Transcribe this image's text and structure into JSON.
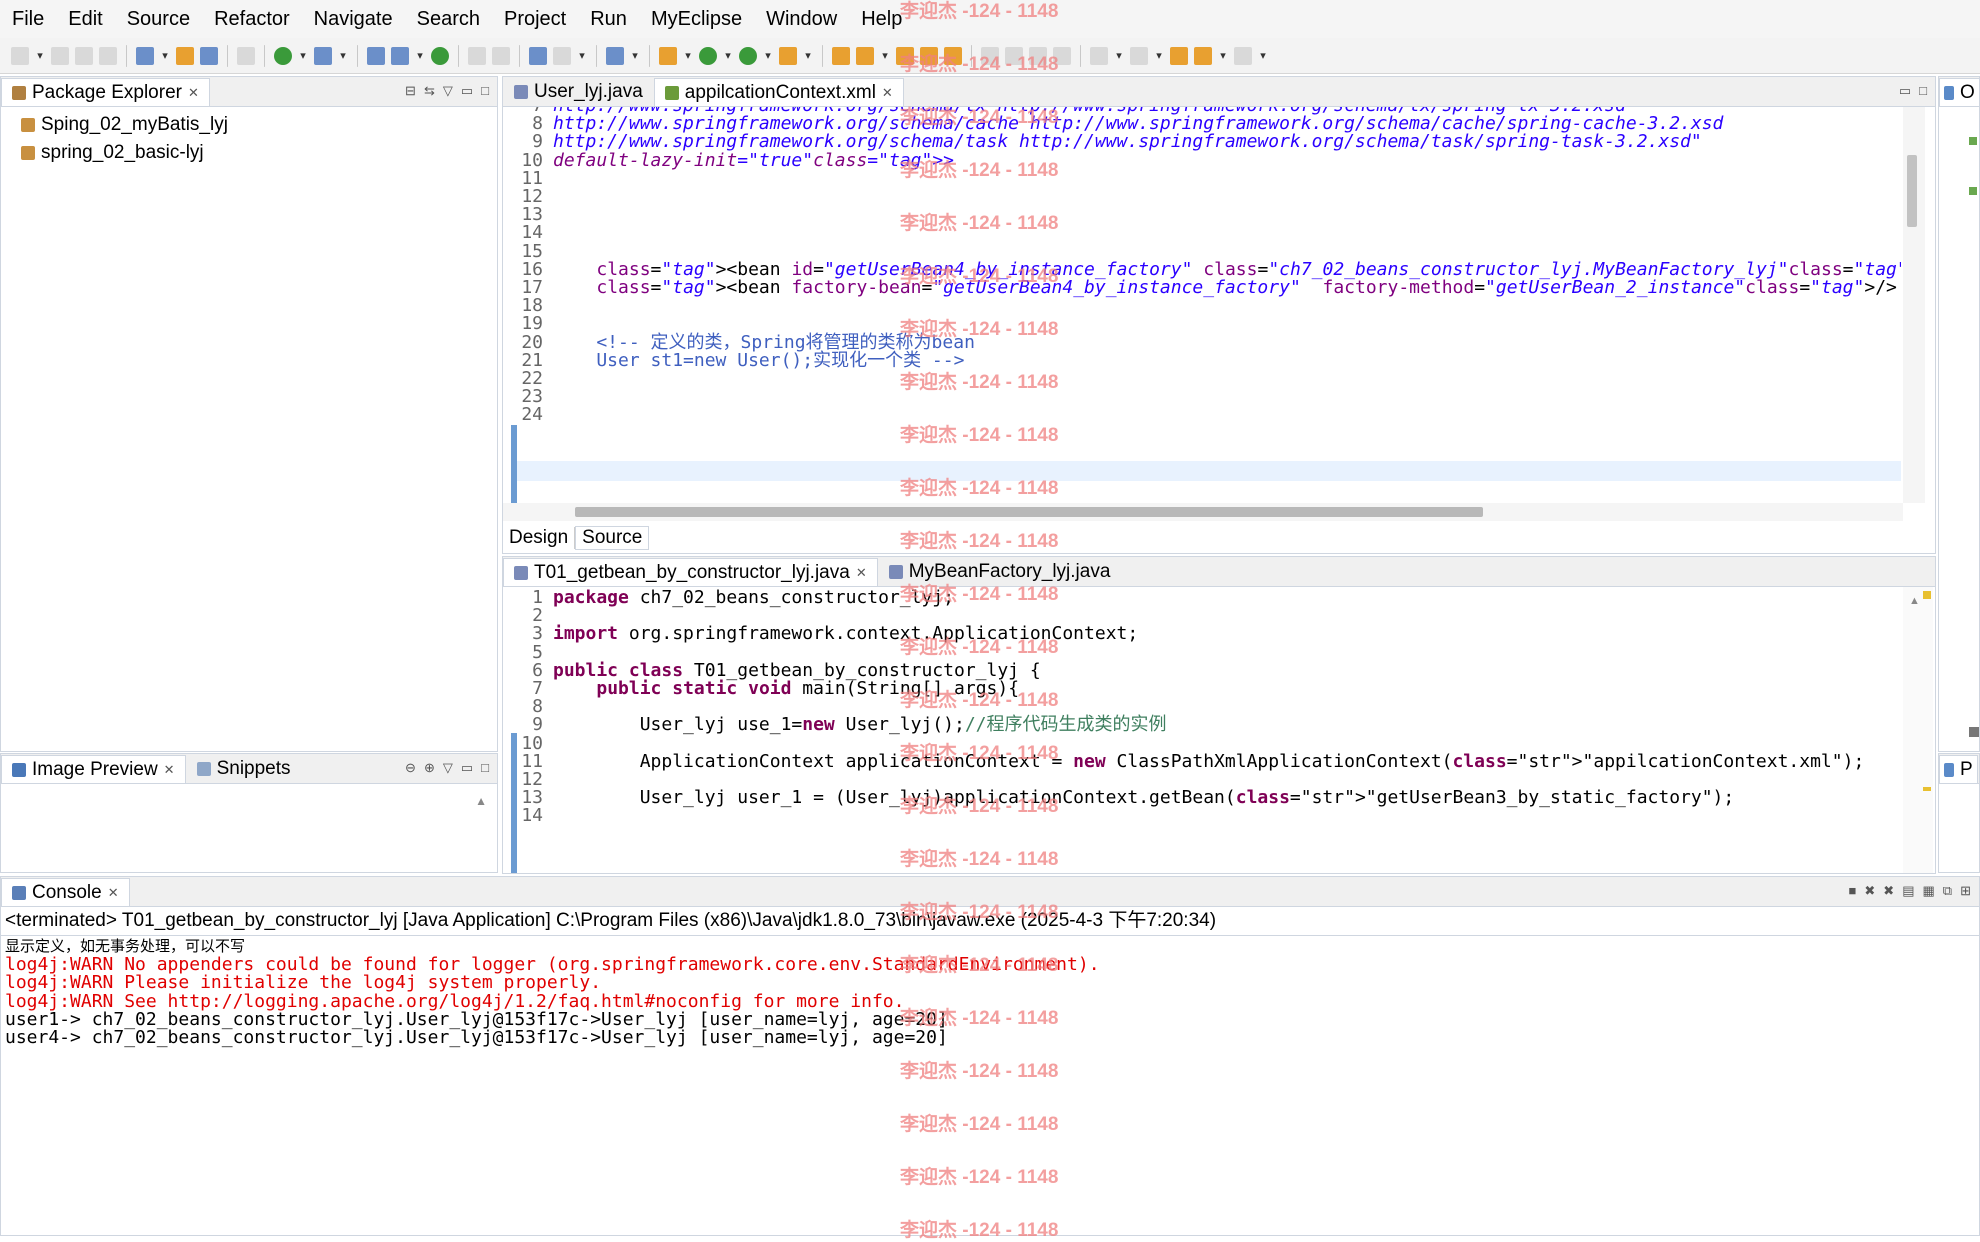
{
  "menu": [
    "File",
    "Edit",
    "Source",
    "Refactor",
    "Navigate",
    "Search",
    "Project",
    "Run",
    "MyEclipse",
    "Window",
    "Help"
  ],
  "package_explorer": {
    "title": "Package Explorer",
    "projects": [
      "Sping_02_myBatis_lyj",
      "spring_02_basic-lyj"
    ]
  },
  "image_preview": {
    "title": "Image Preview",
    "snippets": "Snippets"
  },
  "editor_top": {
    "tabs": [
      "User_lyj.java",
      "appilcationContext.xml"
    ],
    "lines": [
      {
        "n": "7",
        "t": "http://www.springframework.org/schema/tx http://www.springframework.org/schema/tx/spring-tx-3.2.xsd"
      },
      {
        "n": "8",
        "t": "http://www.springframework.org/schema/cache http://www.springframework.org/schema/cache/spring-cache-3.2.xsd"
      },
      {
        "n": "9",
        "t": "http://www.springframework.org/schema/task http://www.springframework.org/schema/task/spring-task-3.2.xsd\""
      },
      {
        "n": "10",
        "t": "default-lazy-init=\"true\">"
      },
      {
        "n": "11",
        "t": ""
      },
      {
        "n": "12",
        "t": ""
      },
      {
        "n": "13",
        "t": ""
      },
      {
        "n": "14",
        "t": ""
      },
      {
        "n": "15",
        "t": ""
      },
      {
        "n": "16",
        "t": "    <bean id=\"getUserBean4_by_instance_factory\" class=\"ch7_02_beans_constructor_lyj.MyBeanFactory_lyj\"/>"
      },
      {
        "n": "17",
        "t": "    <bean factory-bean=\"getUserBean4_by_instance_factory\"  factory-method=\"getUserBean_2_instance\"/>"
      },
      {
        "n": "18",
        "t": ""
      },
      {
        "n": "19",
        "t": ""
      },
      {
        "n": "20",
        "t": "    <!-- 定义的类，Spring将管理的类称为bean"
      },
      {
        "n": "21",
        "t": "    User st1=new User();实现化一个类 -->"
      },
      {
        "n": "22",
        "t": ""
      },
      {
        "n": "23",
        "t": ""
      },
      {
        "n": "24",
        "t": ""
      }
    ],
    "design_tab": "Design",
    "source_tab": "Source"
  },
  "editor_bottom": {
    "tabs": [
      "T01_getbean_by_constructor_lyj.java",
      "MyBeanFactory_lyj.java"
    ],
    "lines": [
      {
        "n": "1",
        "t": "package ch7_02_beans_constructor_lyj;"
      },
      {
        "n": "2",
        "t": ""
      },
      {
        "n": "3",
        "t": "import org.springframework.context.ApplicationContext;"
      },
      {
        "n": "5",
        "t": ""
      },
      {
        "n": "6",
        "t": "public class T01_getbean_by_constructor_lyj {"
      },
      {
        "n": "7",
        "t": "    public static void main(String[] args){"
      },
      {
        "n": "8",
        "t": ""
      },
      {
        "n": "9",
        "t": "        User_lyj use_1=new User_lyj();//程序代码生成类的实例"
      },
      {
        "n": "10",
        "t": ""
      },
      {
        "n": "11",
        "t": "        ApplicationContext applicationContext = new ClassPathXmlApplicationContext(\"appilcationContext.xml\");"
      },
      {
        "n": "12",
        "t": ""
      },
      {
        "n": "13",
        "t": "        User_lyj user_1 = (User_lyj)applicationContext.getBean(\"getUserBean3_by_static_factory\");"
      },
      {
        "n": "14",
        "t": ""
      }
    ]
  },
  "console": {
    "title": "Console",
    "header": "<terminated> T01_getbean_by_constructor_lyj [Java Application] C:\\Program Files (x86)\\Java\\jdk1.8.0_73\\bin\\javaw.exe (2025-4-3 下午7:20:34)",
    "lines": [
      {
        "t": "显示定义，如无事务处理，可以不写",
        "c": "black"
      },
      {
        "t": "log4j:WARN No appenders could be found for logger (org.springframework.core.env.StandardEnvironment).",
        "c": "red"
      },
      {
        "t": "log4j:WARN Please initialize the log4j system properly.",
        "c": "red"
      },
      {
        "t": "log4j:WARN See http://logging.apache.org/log4j/1.2/faq.html#noconfig for more info.",
        "c": "red"
      },
      {
        "t": "user1-> ch7_02_beans_constructor_lyj.User_lyj@153f17c->User_lyj [user_name=lyj, age=20]",
        "c": "black"
      },
      {
        "t": "user4-> ch7_02_beans_constructor_lyj.User_lyj@153f17c->User_lyj [user_name=lyj, age=20]",
        "c": "black"
      }
    ]
  },
  "right_panel": {
    "tab_o": "O",
    "tab_p": "P"
  },
  "watermark": "李迎杰 -124 - 1148"
}
